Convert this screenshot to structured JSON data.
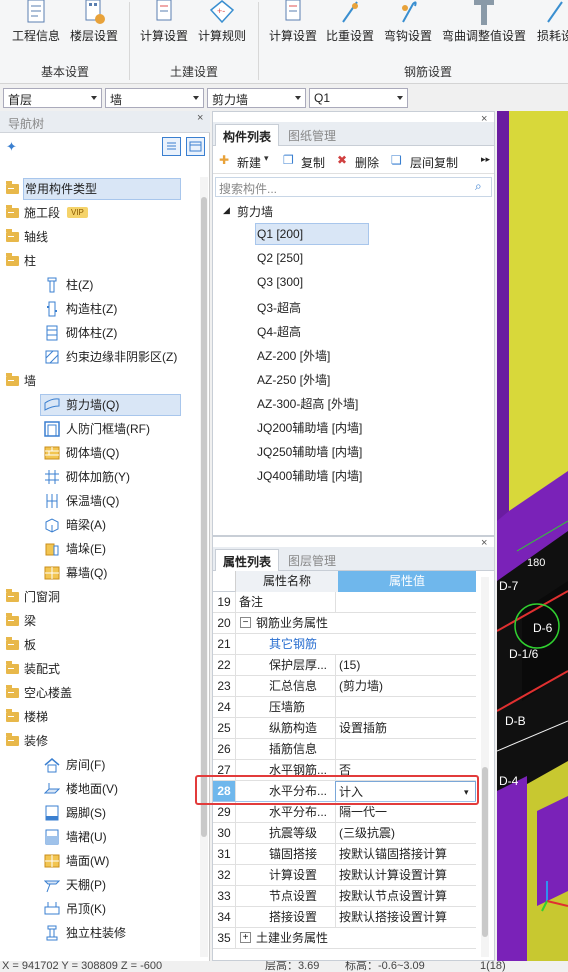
{
  "ribbon": {
    "buttons": [
      {
        "label": "工程信息",
        "icon": "project-info-icon"
      },
      {
        "label": "楼层设置",
        "icon": "floor-settings-icon"
      },
      {
        "label": "计算设置",
        "icon": "calc-settings-icon"
      },
      {
        "label": "计算规则",
        "icon": "calc-rules-icon"
      },
      {
        "label": "计算设置",
        "icon": "rebar-calc-settings-icon"
      },
      {
        "label": "比重设置",
        "icon": "density-settings-icon"
      },
      {
        "label": "弯钩设置",
        "icon": "hook-settings-icon"
      },
      {
        "label": "弯曲调整值设置",
        "icon": "bend-adjust-icon"
      },
      {
        "label": "损耗设",
        "icon": "loss-settings-icon"
      }
    ],
    "groups": [
      "基本设置",
      "土建设置",
      "钢筋设置"
    ]
  },
  "selectors": {
    "floor": "首层",
    "category": "墙",
    "type": "剪力墙",
    "component": "Q1"
  },
  "nav": {
    "title": "导航树",
    "items": [
      {
        "label": "常用构件类型",
        "level": 0,
        "selected": true
      },
      {
        "label": "施工段",
        "level": 0,
        "badge": "VIP"
      },
      {
        "label": "轴线",
        "level": 0
      },
      {
        "label": "柱",
        "level": 0
      },
      {
        "label": "柱(Z)",
        "level": 1
      },
      {
        "label": "构造柱(Z)",
        "level": 1
      },
      {
        "label": "砌体柱(Z)",
        "level": 1
      },
      {
        "label": "约束边缘非阴影区(Z)",
        "level": 1
      },
      {
        "label": "墙",
        "level": 0
      },
      {
        "label": "剪力墙(Q)",
        "level": 1,
        "selected": true
      },
      {
        "label": "人防门框墙(RF)",
        "level": 1
      },
      {
        "label": "砌体墙(Q)",
        "level": 1
      },
      {
        "label": "砌体加筋(Y)",
        "level": 1
      },
      {
        "label": "保温墙(Q)",
        "level": 1
      },
      {
        "label": "暗梁(A)",
        "level": 1
      },
      {
        "label": "墙垛(E)",
        "level": 1
      },
      {
        "label": "幕墙(Q)",
        "level": 1
      },
      {
        "label": "门窗洞",
        "level": 0
      },
      {
        "label": "梁",
        "level": 0
      },
      {
        "label": "板",
        "level": 0
      },
      {
        "label": "装配式",
        "level": 0
      },
      {
        "label": "空心楼盖",
        "level": 0
      },
      {
        "label": "楼梯",
        "level": 0
      },
      {
        "label": "装修",
        "level": 0
      },
      {
        "label": "房间(F)",
        "level": 1
      },
      {
        "label": "楼地面(V)",
        "level": 1
      },
      {
        "label": "踢脚(S)",
        "level": 1
      },
      {
        "label": "墙裙(U)",
        "level": 1
      },
      {
        "label": "墙面(W)",
        "level": 1
      },
      {
        "label": "天棚(P)",
        "level": 1
      },
      {
        "label": "吊顶(K)",
        "level": 1
      },
      {
        "label": "独立柱装修",
        "level": 1
      }
    ]
  },
  "components": {
    "tabs": [
      "构件列表",
      "图纸管理"
    ],
    "toolbar": {
      "new": "新建",
      "copy": "复制",
      "delete": "删除",
      "floor_copy": "层间复制"
    },
    "search_placeholder": "搜索构件...",
    "group": "剪力墙",
    "items": [
      "Q1 [200]",
      "Q2 [250]",
      "Q3 [300]",
      "Q3-超高",
      "Q4-超高",
      "AZ-200 [外墙]",
      "AZ-250 [外墙]",
      "AZ-300-超高 [外墙]",
      "JQ200辅助墙 [内墙]",
      "JQ250辅助墙 [内墙]",
      "JQ400辅助墙 [内墙]"
    ]
  },
  "properties": {
    "tabs": [
      "属性列表",
      "图层管理"
    ],
    "headers": [
      "属性名称",
      "属性值"
    ],
    "rows": [
      {
        "n": "19",
        "k": "备注",
        "v": ""
      },
      {
        "n": "20",
        "k": "钢筋业务属性",
        "v": "",
        "expander": "−"
      },
      {
        "n": "21",
        "k": "其它钢筋",
        "v": "",
        "link": true
      },
      {
        "n": "22",
        "k": "保护层厚...",
        "v": "(15)"
      },
      {
        "n": "23",
        "k": "汇总信息",
        "v": "(剪力墙)"
      },
      {
        "n": "24",
        "k": "压墙筋",
        "v": ""
      },
      {
        "n": "25",
        "k": "纵筋构造",
        "v": "设置插筋"
      },
      {
        "n": "26",
        "k": "插筋信息",
        "v": ""
      },
      {
        "n": "27",
        "k": "水平钢筋...",
        "v": "否"
      },
      {
        "n": "28",
        "k": "水平分布...",
        "v": "计入",
        "active": true
      },
      {
        "n": "29",
        "k": "水平分布...",
        "v": "隔一代一"
      },
      {
        "n": "30",
        "k": "抗震等级",
        "v": "(三级抗震)"
      },
      {
        "n": "31",
        "k": "锚固搭接",
        "v": "按默认锚固搭接计算"
      },
      {
        "n": "32",
        "k": "计算设置",
        "v": "按默认计算设置计算"
      },
      {
        "n": "33",
        "k": "节点设置",
        "v": "按默认节点设置计算"
      },
      {
        "n": "34",
        "k": "搭接设置",
        "v": "按默认搭接设置计算"
      },
      {
        "n": "35",
        "k": "土建业务属性",
        "v": "",
        "expander": "+"
      }
    ]
  },
  "viewport_labels": [
    "D-7",
    "D-6",
    "D-1/6",
    "D-B",
    "D-4",
    "180"
  ],
  "status": {
    "coords": "X = 941702 Y = 308809 Z = -600",
    "floor_height": "层高：3.69",
    "elevation": "标高：-0.6~3.09",
    "page": "1(18)"
  }
}
